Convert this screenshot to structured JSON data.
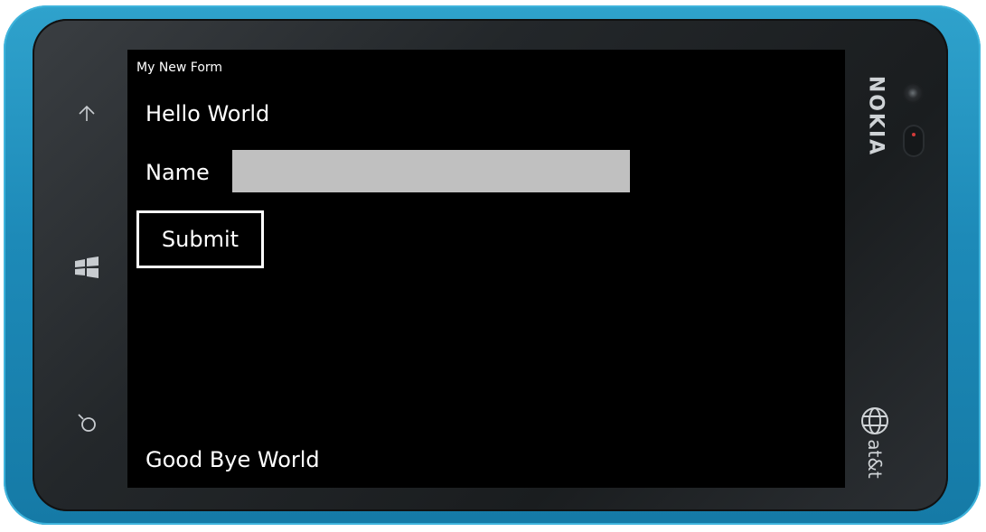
{
  "device": {
    "brand": "NOKIA",
    "carrier": "at&t",
    "buttons": {
      "back": "back-arrow-icon",
      "start": "windows-logo-icon",
      "search": "search-icon"
    }
  },
  "form": {
    "title": "My New Form",
    "hello_label": "Hello World",
    "name_label": "Name",
    "name_value": "",
    "submit_label": "Submit",
    "goodbye_label": "Good Bye World"
  },
  "colors": {
    "shell": "#1d8ab8",
    "screen_bg": "#000000",
    "text": "#ffffff",
    "input_bg": "#c0c0c0"
  }
}
